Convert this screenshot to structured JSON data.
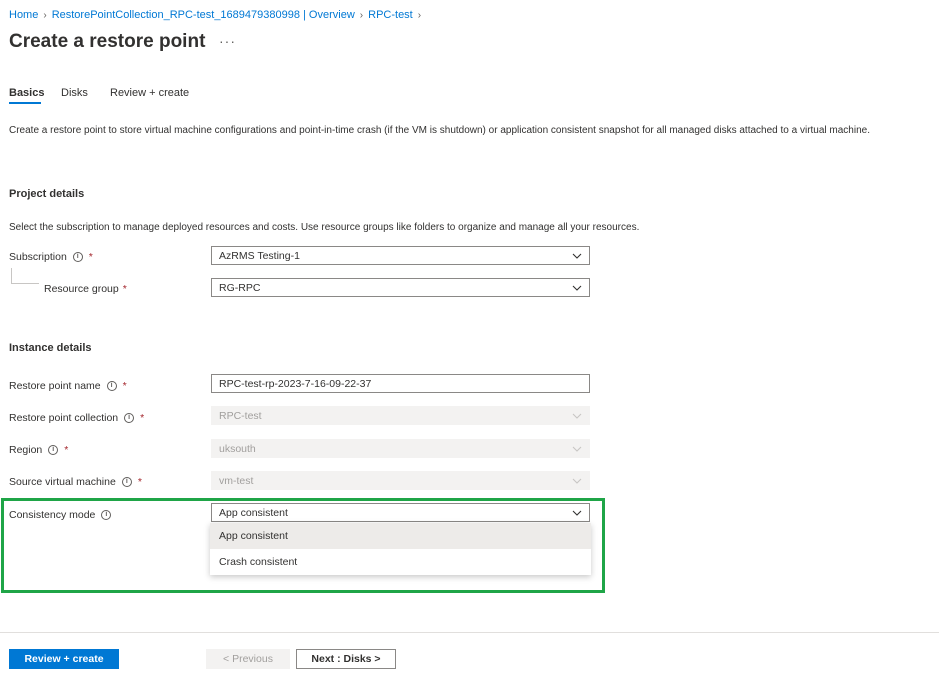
{
  "breadcrumb": {
    "items": [
      "Home",
      "RestorePointCollection_RPC-test_1689479380998 | Overview",
      "RPC-test"
    ]
  },
  "page": {
    "title": "Create a restore point",
    "more": "···"
  },
  "tabs": [
    {
      "label": "Basics"
    },
    {
      "label": "Disks"
    },
    {
      "label": "Review + create"
    }
  ],
  "description": "Create a restore point to store virtual machine configurations and point-in-time crash (if the VM is shutdown) or application consistent snapshot for all managed disks attached to a virtual machine.",
  "project": {
    "title": "Project details",
    "description": "Select the subscription to manage deployed resources and costs. Use resource groups like folders to organize and manage all your resources.",
    "subscription_label": "Subscription",
    "subscription_value": "AzRMS Testing-1",
    "resource_group_label": "Resource group",
    "resource_group_value": "RG-RPC"
  },
  "instance": {
    "title": "Instance details",
    "restore_point_name_label": "Restore point name",
    "restore_point_name_value": "RPC-test-rp-2023-7-16-09-22-37",
    "collection_label": "Restore point collection",
    "collection_value": "RPC-test",
    "region_label": "Region",
    "region_value": "uksouth",
    "source_vm_label": "Source virtual machine",
    "source_vm_value": "vm-test",
    "consistency_label": "Consistency mode",
    "consistency_value": "App consistent",
    "consistency_options": [
      "App consistent",
      "Crash consistent"
    ]
  },
  "required_mark": "*",
  "info_glyph": "i",
  "footer": {
    "review_label": "Review + create",
    "previous_label": "< Previous",
    "next_label": "Next : Disks >"
  },
  "colors": {
    "accent": "#0078d4",
    "highlight": "#1fa547",
    "required": "#a4262c"
  }
}
